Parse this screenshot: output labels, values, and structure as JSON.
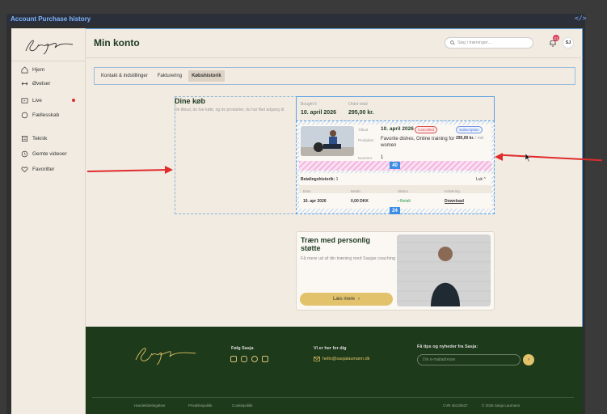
{
  "window": {
    "title": "Account Purchase history",
    "code_icon": "</>"
  },
  "header": {
    "title": "Min konto",
    "search_placeholder": "Søg i træninger...",
    "notification_count": "21",
    "avatar_initials": "SJ"
  },
  "sidebar": {
    "items": [
      {
        "label": "Hjem",
        "icon": "home-icon"
      },
      {
        "label": "Øvelser",
        "icon": "dumbbell-icon"
      },
      {
        "label": "Live",
        "icon": "live-icon"
      },
      {
        "label": "Fællesskab",
        "icon": "chat-icon"
      },
      {
        "label": "Teknik",
        "icon": "book-icon"
      },
      {
        "label": "Gemte videoer",
        "icon": "clock-icon"
      },
      {
        "label": "Favoritter",
        "icon": "heart-icon"
      }
    ],
    "live_dot_color": "#e02b2b"
  },
  "tabs": [
    {
      "label": "Kontakt & indstillinger",
      "active": false
    },
    {
      "label": "Fakturering",
      "active": false
    },
    {
      "label": "Købshistorik",
      "active": true
    }
  ],
  "purchases": {
    "title": "Dine køb",
    "subtitle": "De tilbud, du har købt, og de produkter, du har fået adgang til.",
    "bought_label": "Bought it",
    "bought_value": "10. april 2026",
    "total_label": "Order total",
    "total_value": "295,00 kr.",
    "order": {
      "bought_label": "Tilbud",
      "date": "10. april 2026",
      "status_badge": "Cancelled",
      "type_badge": "Subscription",
      "price": "295,00 kr.",
      "price_period": "/ md.",
      "products_label": "Produkter",
      "products_value": "Favorite dishes, Online training for women",
      "number_label": "Nummer",
      "number_value": "1",
      "tag_top": "40"
    },
    "payments": {
      "title": "Betalingshistorik:",
      "count": "1",
      "close_label": "Luk ^",
      "headers": [
        "Dato",
        "Beløb",
        "Status",
        "Kvittering"
      ],
      "rows": [
        {
          "date": "10. apr 2026",
          "amount": "0,00 DKK",
          "status": "• Betalt",
          "receipt": "Download"
        }
      ],
      "tag_bottom": "24"
    }
  },
  "promo": {
    "title": "Træn med personlig støtte",
    "subtitle": "Få mere ud af din træning med Sasjas coaching",
    "button_label": "Læs mere",
    "button_icon": "chevron-right-icon"
  },
  "footer": {
    "follow_label": "Følg Sasja",
    "contact_label": "Vi er her for dig",
    "email": "hello@sasjalaumann.dk",
    "newsletter_label": "Få tips og nyheder fra Sasja:",
    "newsletter_placeholder": "Din e-mailadresse",
    "links": [
      "Handelsbetingelser",
      "Privatlivspolitik",
      "Cookiepolitik"
    ],
    "cvr": "CVR 46130537",
    "copyright": "© 2026 Sasja Laumann"
  },
  "colors": {
    "accent": "#e2c36b",
    "brand_green": "#1d3a1a",
    "selection": "#5aa0e6"
  }
}
